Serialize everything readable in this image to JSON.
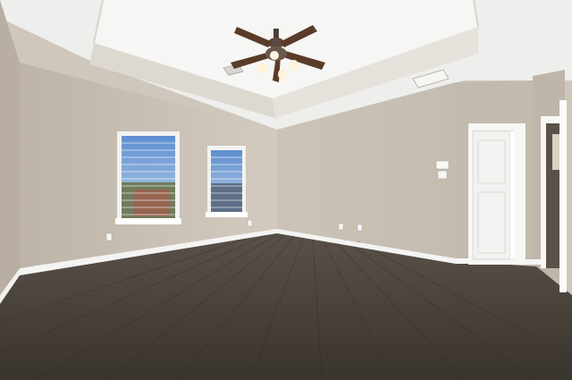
{
  "scene": {
    "description_tag": "empty-room-photo",
    "palette": {
      "ceiling": "#f2f2f0",
      "ceiling_tray": "#f7f7f5",
      "wall_left": "#cdc5ba",
      "wall_back": "#c8c0b3",
      "wall_right": "#c3bbae",
      "trim": "#ffffff",
      "floor_dark": "#3e3832",
      "floor_light": "#5e554c",
      "sky": "#7fa6d8",
      "fan_blade": "#5a3b28",
      "fan_body": "#4a4038"
    }
  }
}
